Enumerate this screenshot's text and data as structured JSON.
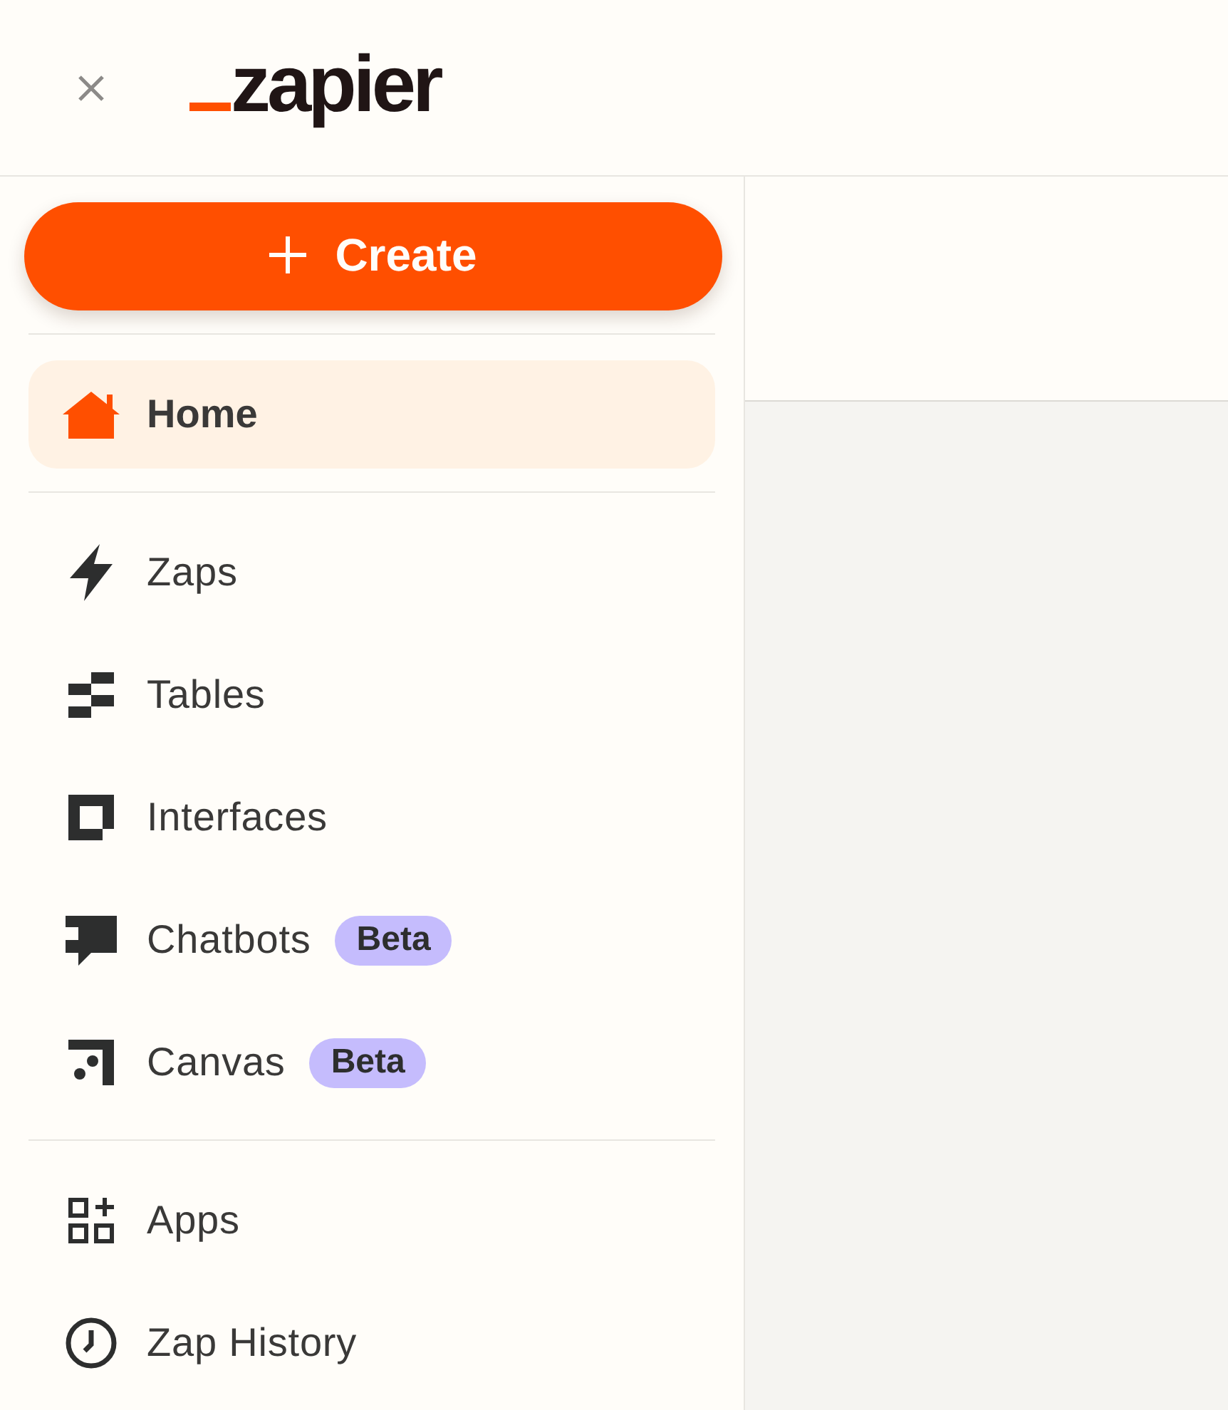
{
  "header": {
    "logo_text": "zapier"
  },
  "sidebar": {
    "create_button": {
      "label": "Create"
    },
    "sections": [
      {
        "items": [
          {
            "label": "Home",
            "selected": true
          }
        ]
      },
      {
        "items": [
          {
            "label": "Zaps",
            "selected": false
          },
          {
            "label": "Tables",
            "selected": false
          },
          {
            "label": "Interfaces",
            "selected": false
          },
          {
            "label": "Chatbots",
            "selected": false,
            "badge": "Beta"
          },
          {
            "label": "Canvas",
            "selected": false,
            "badge": "Beta"
          }
        ]
      },
      {
        "items": [
          {
            "label": "Apps",
            "selected": false
          },
          {
            "label": "Zap History",
            "selected": false
          }
        ]
      }
    ]
  }
}
